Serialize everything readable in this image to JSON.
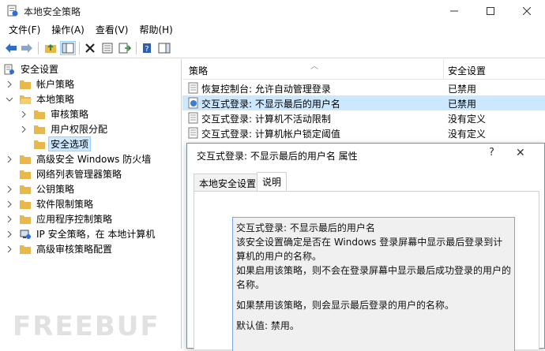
{
  "window": {
    "title": "本地安全策略"
  },
  "menu": [
    "文件(F)",
    "操作(A)",
    "查看(V)",
    "帮助(H)"
  ],
  "tree": [
    {
      "label": "安全设置",
      "icon": "security-settings-icon"
    },
    {
      "label": "帐户策略"
    },
    {
      "label": "本地策略"
    },
    {
      "label": "审核策略"
    },
    {
      "label": "用户权限分配"
    },
    {
      "label": "安全选项"
    },
    {
      "label": "高级安全 Windows 防火墙"
    },
    {
      "label": "网络列表管理器策略"
    },
    {
      "label": "公钥策略"
    },
    {
      "label": "软件限制策略"
    },
    {
      "label": "应用程序控制策略"
    },
    {
      "label": "IP 安全策略，在 本地计算机"
    },
    {
      "label": "高级审核策略配置"
    }
  ],
  "list": {
    "headers": {
      "policy": "策略",
      "setting": "安全设置"
    },
    "rows": [
      {
        "policy": "恢复控制台: 允许自动管理登录",
        "setting": "已禁用"
      },
      {
        "policy": "交互式登录: 不显示最后的用户名",
        "setting": "已禁用"
      },
      {
        "policy": "交互式登录: 计算机不活动限制",
        "setting": "没有定义"
      },
      {
        "policy": "交互式登录: 计算机帐户锁定阈值",
        "setting": "没有定义"
      }
    ]
  },
  "dialog": {
    "title": "交互式登录: 不显示最后的用户名 属性",
    "help": "?",
    "close": "✕",
    "tabs": [
      "本地安全设置",
      "说明"
    ],
    "explain": {
      "line1": "交互式登录: 不显示最后的用户名",
      "line2": "该安全设置确定是否在 Windows 登录屏幕中显示最后登录到计算机的用户的名称。",
      "line3": "如果启用该策略，则不会在登录屏幕中显示最后成功登录的用户的名称。",
      "line4": "如果禁用该策略，则会显示最后登录的用户的名称。",
      "line5": "默认值: 禁用。"
    }
  },
  "watermark": "FREEBUF",
  "colors": {
    "selection": "#cce8ff",
    "selection_border": "#99d1ff",
    "folder": "#e8b84a",
    "dialog_border": "#7a8ea8"
  }
}
